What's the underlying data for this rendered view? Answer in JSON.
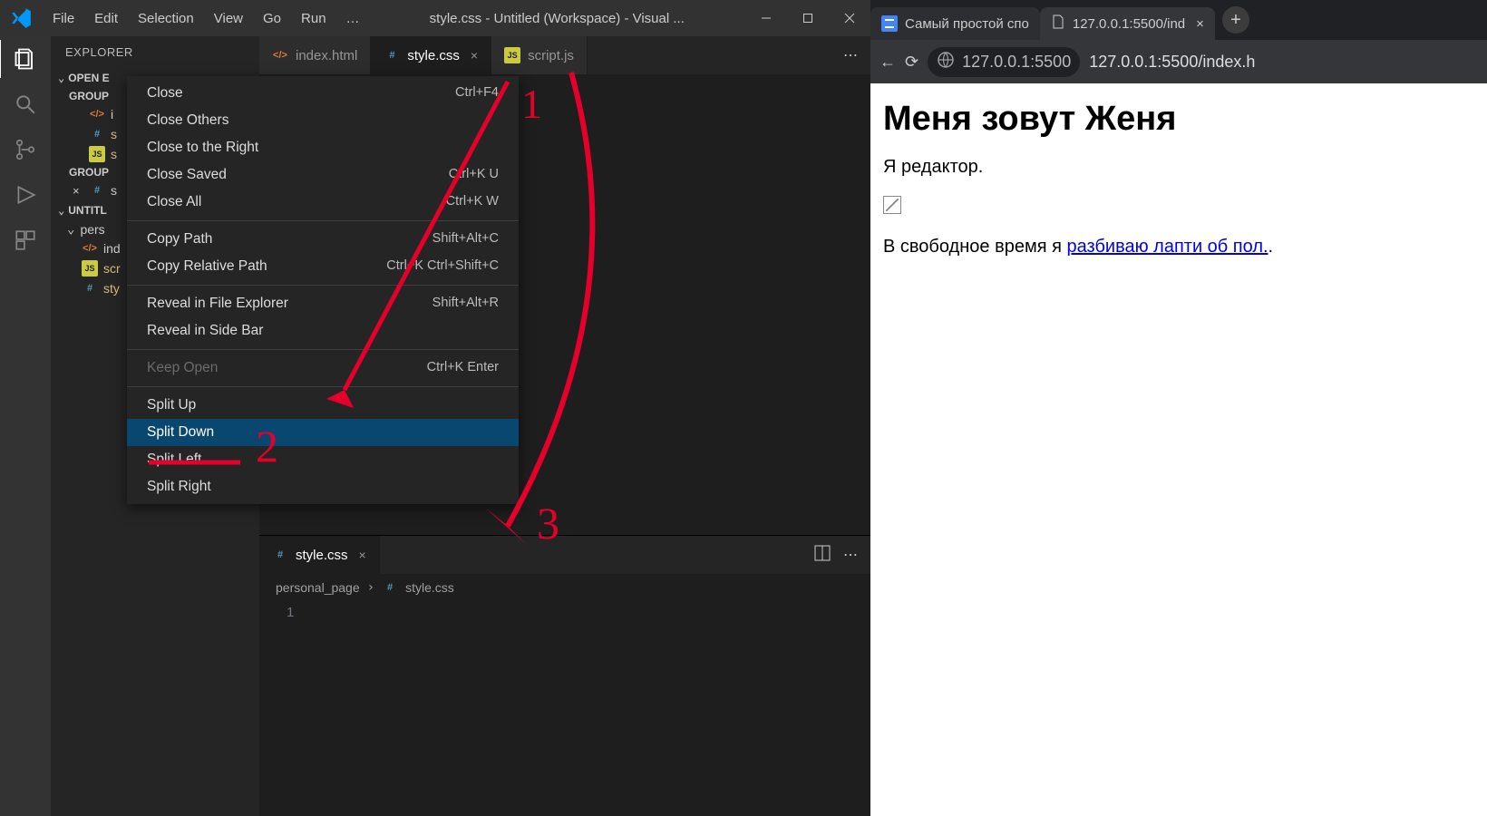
{
  "vscode": {
    "menus": [
      "File",
      "Edit",
      "Selection",
      "View",
      "Go",
      "Run",
      "…"
    ],
    "window_title": "style.css - Untitled (Workspace) - Visual ...",
    "sidebar": {
      "header": "EXPLORER",
      "open_editors_label": "OPEN E",
      "group1_label": "GROUP",
      "group2_label": "GROUP",
      "open_editors_g1": [
        {
          "name": "i",
          "type": "html",
          "mod": false,
          "close": false
        },
        {
          "name": "s",
          "type": "css",
          "mod": true,
          "close": false
        },
        {
          "name": "s",
          "type": "js",
          "mod": true,
          "close": false
        }
      ],
      "open_editors_g2": [
        {
          "name": "s",
          "type": "css",
          "mod": false,
          "close": true
        }
      ],
      "workspace_label": "UNTITL",
      "folder": "pers",
      "files": [
        {
          "name": "ind",
          "type": "html",
          "mod": false
        },
        {
          "name": "scr",
          "type": "js",
          "mod": true
        },
        {
          "name": "sty",
          "type": "css",
          "mod": true
        }
      ]
    },
    "tabs_top": [
      {
        "name": "index.html",
        "type": "html",
        "active": false,
        "close": false
      },
      {
        "name": "style.css",
        "type": "css",
        "active": true,
        "close": true
      },
      {
        "name": "script.js",
        "type": "js",
        "active": false,
        "close": false
      }
    ],
    "tabs_bottom": [
      {
        "name": "style.css",
        "type": "css",
        "active": true,
        "close": true
      }
    ],
    "breadcrumb": {
      "folder": "personal_page",
      "file": "style.css"
    },
    "gutter_line": "1",
    "context_menu": [
      {
        "label": "Close",
        "kb": "Ctrl+F4"
      },
      {
        "label": "Close Others",
        "kb": ""
      },
      {
        "label": "Close to the Right",
        "kb": ""
      },
      {
        "label": "Close Saved",
        "kb": "Ctrl+K U"
      },
      {
        "label": "Close All",
        "kb": "Ctrl+K W"
      },
      {
        "sep": true
      },
      {
        "label": "Copy Path",
        "kb": "Shift+Alt+C"
      },
      {
        "label": "Copy Relative Path",
        "kb": "Ctrl+K Ctrl+Shift+C"
      },
      {
        "sep": true
      },
      {
        "label": "Reveal in File Explorer",
        "kb": "Shift+Alt+R"
      },
      {
        "label": "Reveal in Side Bar",
        "kb": ""
      },
      {
        "sep": true
      },
      {
        "label": "Keep Open",
        "kb": "Ctrl+K Enter",
        "disabled": true
      },
      {
        "sep": true
      },
      {
        "label": "Split Up",
        "kb": ""
      },
      {
        "label": "Split Down",
        "kb": "",
        "hover": true
      },
      {
        "label": "Split Left",
        "kb": ""
      },
      {
        "label": "Split Right",
        "kb": ""
      }
    ]
  },
  "browser": {
    "tabs": [
      {
        "title": "Самый простой спо",
        "icon": "docs",
        "active": false
      },
      {
        "title": "127.0.0.1:5500/ind",
        "icon": "file",
        "active": true,
        "close": true
      }
    ],
    "url_chip": "127.0.0.1:5500",
    "url_rest": "127.0.0.1:5500/index.h",
    "page": {
      "h1": "Меня зовут Женя",
      "p1": "Я редактор.",
      "p2_pre": "В свободное время я ",
      "p2_link": "разбиваю лапти об пол.",
      "p2_post": "."
    }
  },
  "annotations": {
    "n1": "1",
    "n2": "2",
    "n3": "3"
  }
}
